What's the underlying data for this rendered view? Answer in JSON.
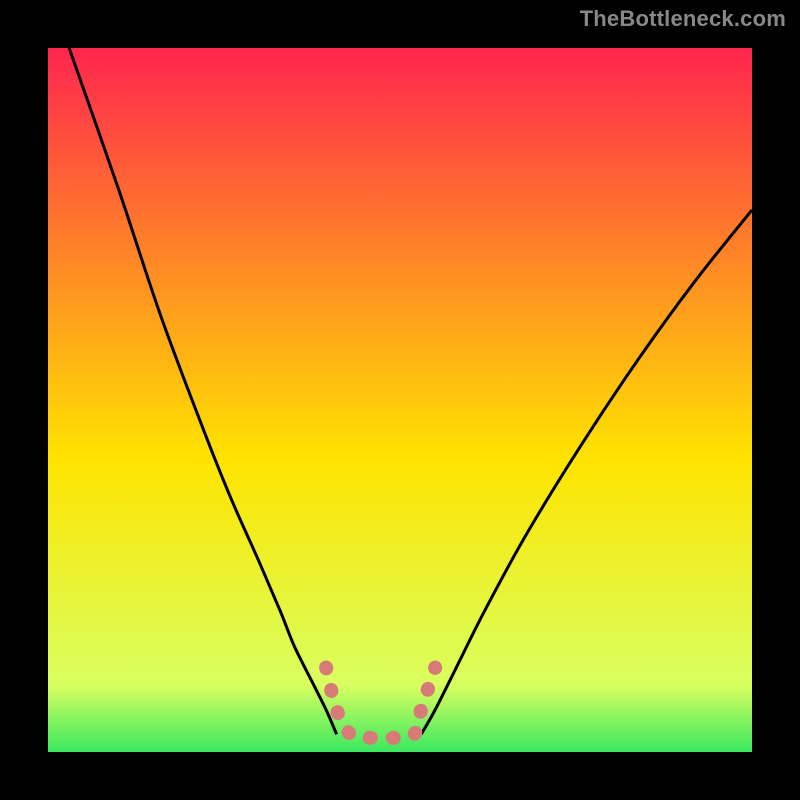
{
  "watermark": "TheBottleneck.com",
  "chart_data": {
    "type": "line",
    "title": "",
    "xlabel": "",
    "ylabel": "",
    "xlim": [
      0,
      100
    ],
    "ylim": [
      0,
      100
    ],
    "grid": false,
    "legend": false,
    "background_gradient_top": "#ff1a53",
    "background_gradient_mid": "#ffe400",
    "background_gradient_bottom": "#00e060",
    "series": [
      {
        "name": "left-curve",
        "x": [
          3,
          10,
          16,
          22,
          26,
          30,
          33,
          35,
          37.5,
          39.5,
          41
        ],
        "values": [
          100,
          80,
          62,
          46,
          36,
          27,
          20,
          15,
          10,
          6,
          2.5
        ]
      },
      {
        "name": "right-curve",
        "x": [
          53,
          55,
          58,
          62,
          68,
          76,
          84,
          92,
          100
        ],
        "values": [
          2.5,
          6,
          12,
          20,
          31,
          44,
          56,
          67,
          77
        ]
      },
      {
        "name": "valley-dotted",
        "x": [
          39.5,
          41,
          43,
          46,
          49,
          52,
          53,
          55
        ],
        "values": [
          12,
          6,
          2.5,
          2,
          2,
          2.5,
          6,
          12
        ]
      }
    ],
    "dotted_style": {
      "stroke": "#d87a78",
      "width": 14,
      "dash": "1 22",
      "linecap": "round"
    },
    "curve_style": {
      "stroke": "#000000",
      "width": 3
    }
  },
  "plot_frame": {
    "stroke": "#000000",
    "width": 28
  }
}
